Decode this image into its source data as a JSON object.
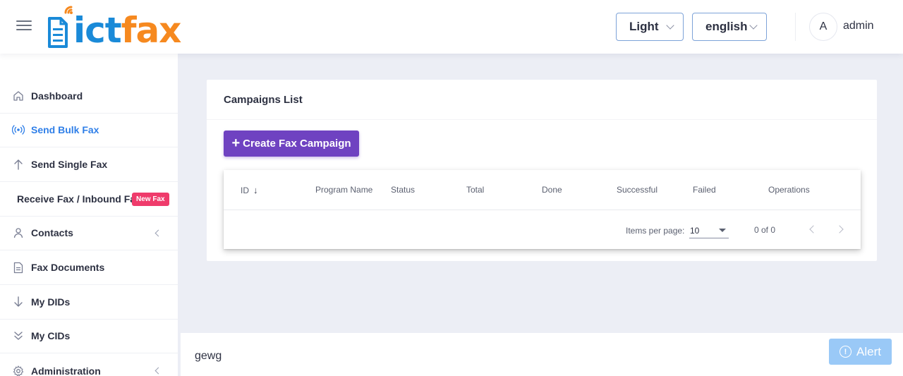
{
  "header": {
    "logo_ict": "ict",
    "logo_fax": "fax",
    "theme_value": "Light",
    "language_value": "english",
    "avatar_initial": "A",
    "username": "admin"
  },
  "sidebar": {
    "items": [
      {
        "label": "Dashboard",
        "icon": "home-icon"
      },
      {
        "label": "Send Bulk Fax",
        "icon": "broadcast-icon"
      },
      {
        "label": "Send Single Fax",
        "icon": "arrow-up-icon"
      },
      {
        "label": "Receive Fax / Inbound Fax",
        "badge": "New Fax"
      },
      {
        "label": "Contacts",
        "icon": "user-icon"
      },
      {
        "label": "Fax Documents",
        "icon": "document-icon"
      },
      {
        "label": "My DIDs",
        "icon": "arrow-down-icon"
      },
      {
        "label": "My CIDs",
        "icon": "double-chevron-down-icon"
      },
      {
        "label": "Administration",
        "icon": "gear-icon"
      }
    ]
  },
  "main": {
    "card_title": "Campaigns List",
    "create_button": "Create Fax Campaign",
    "table": {
      "columns": [
        "ID",
        "Program Name",
        "Status",
        "Total",
        "Done",
        "Successful",
        "Failed",
        "Operations"
      ],
      "rows": []
    },
    "pager": {
      "items_per_page_label": "Items per page:",
      "items_per_page_value": "10",
      "range_label": "0 of 0"
    }
  },
  "footer": {
    "text": "gewg",
    "alert_label": "Alert"
  },
  "colors": {
    "accent_purple": "#6f42c1",
    "active_blue": "#2f7fe8",
    "badge_pink": "#ef3b6b",
    "logo_blue": "#1a8ad8",
    "logo_orange": "#f6891f",
    "alert_blue": "#9ac9f7"
  }
}
